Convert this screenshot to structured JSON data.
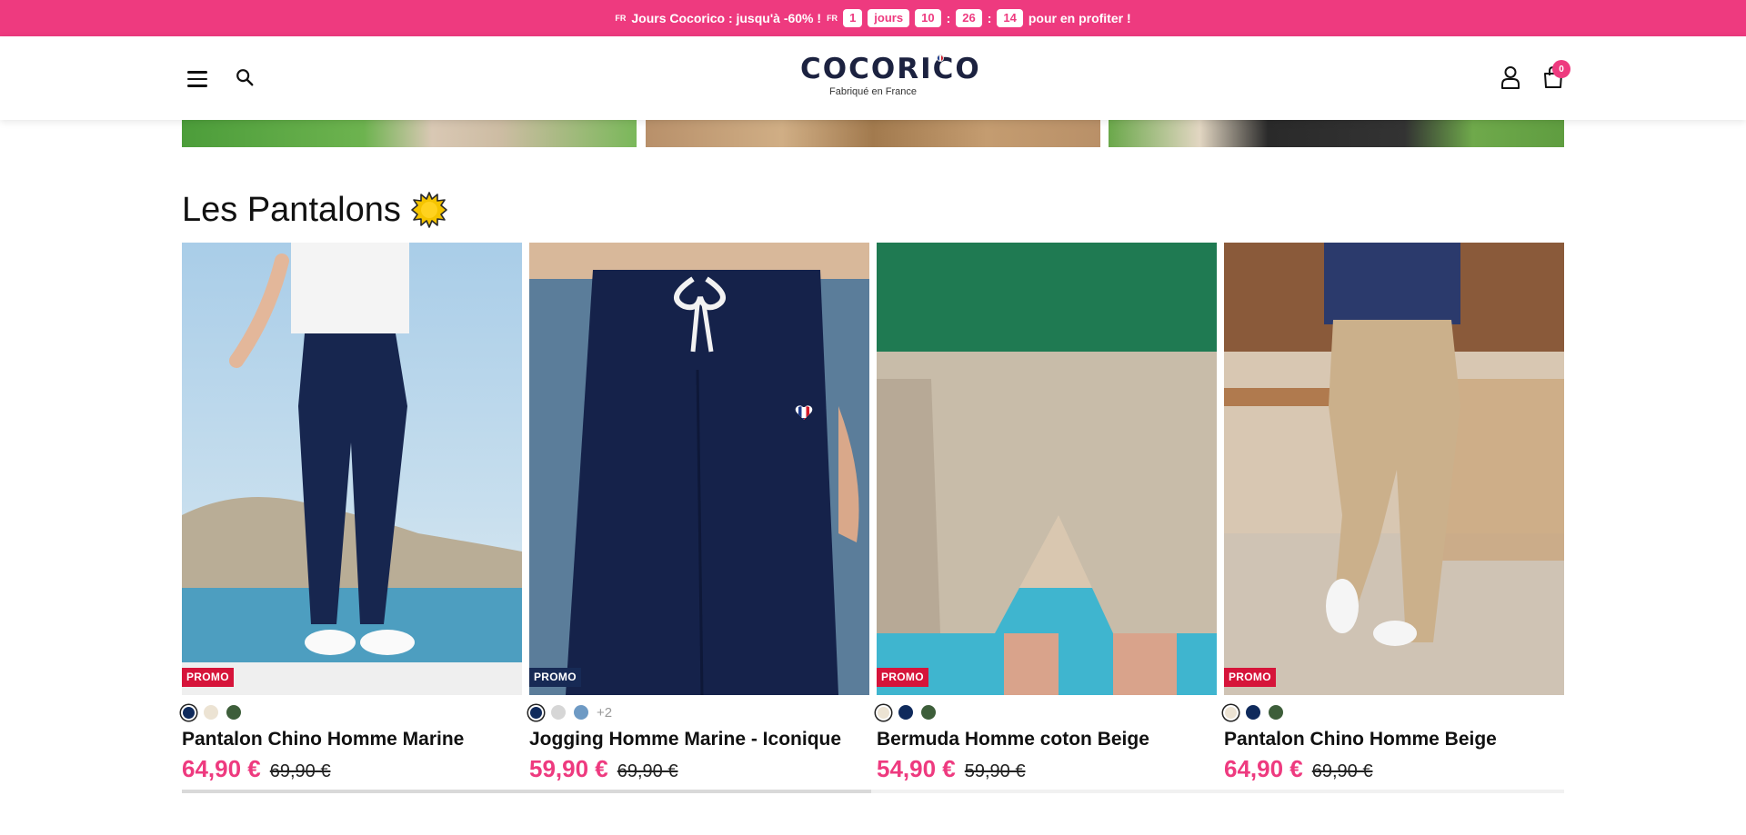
{
  "promo": {
    "flag_left": "FR",
    "text": "Jours Cocorico : jusqu'à -60% !",
    "flag_right": "FR",
    "days": "1",
    "days_label": "jours",
    "hours": "10",
    "minutes": "26",
    "seconds": "14",
    "cta": "pour en profiter !",
    "colon": ":"
  },
  "header": {
    "logo_text": "COCORICO",
    "tagline": "Fabriqué en France",
    "cart_count": "0"
  },
  "section": {
    "title": "Les Pantalons"
  },
  "products": [
    {
      "badge": "PROMO",
      "name": "Pantalon Chino Homme Marine",
      "price": "64,90 €",
      "old_price": "69,90 €",
      "swatches": [
        "#0f2a5c",
        "#ece3d3",
        "#3d5e3a"
      ]
    },
    {
      "badge": "PROMO",
      "name": "Jogging Homme Marine - Iconique",
      "price": "59,90 €",
      "old_price": "69,90 €",
      "swatches": [
        "#0f2a5c",
        "#d6d6d6",
        "#6e9ac4"
      ],
      "more": "+2"
    },
    {
      "badge": "PROMO",
      "name": "Bermuda Homme coton Beige",
      "price": "54,90 €",
      "old_price": "59,90 €",
      "swatches": [
        "#ece3d3",
        "#0f2a5c",
        "#3d5e3a"
      ]
    },
    {
      "badge": "PROMO",
      "name": "Pantalon Chino Homme Beige",
      "price": "64,90 €",
      "old_price": "69,90 €",
      "swatches": [
        "#ece3d3",
        "#0f2a5c",
        "#3d5e3a"
      ]
    }
  ],
  "colors": {
    "accent": "#ee3a7f",
    "promo_red": "#d6143a",
    "promo_navy": "#172a55"
  },
  "icons": [
    "menu-icon",
    "search-icon",
    "user-icon",
    "cart-icon",
    "sun-icon",
    "heart-flag-icon"
  ]
}
